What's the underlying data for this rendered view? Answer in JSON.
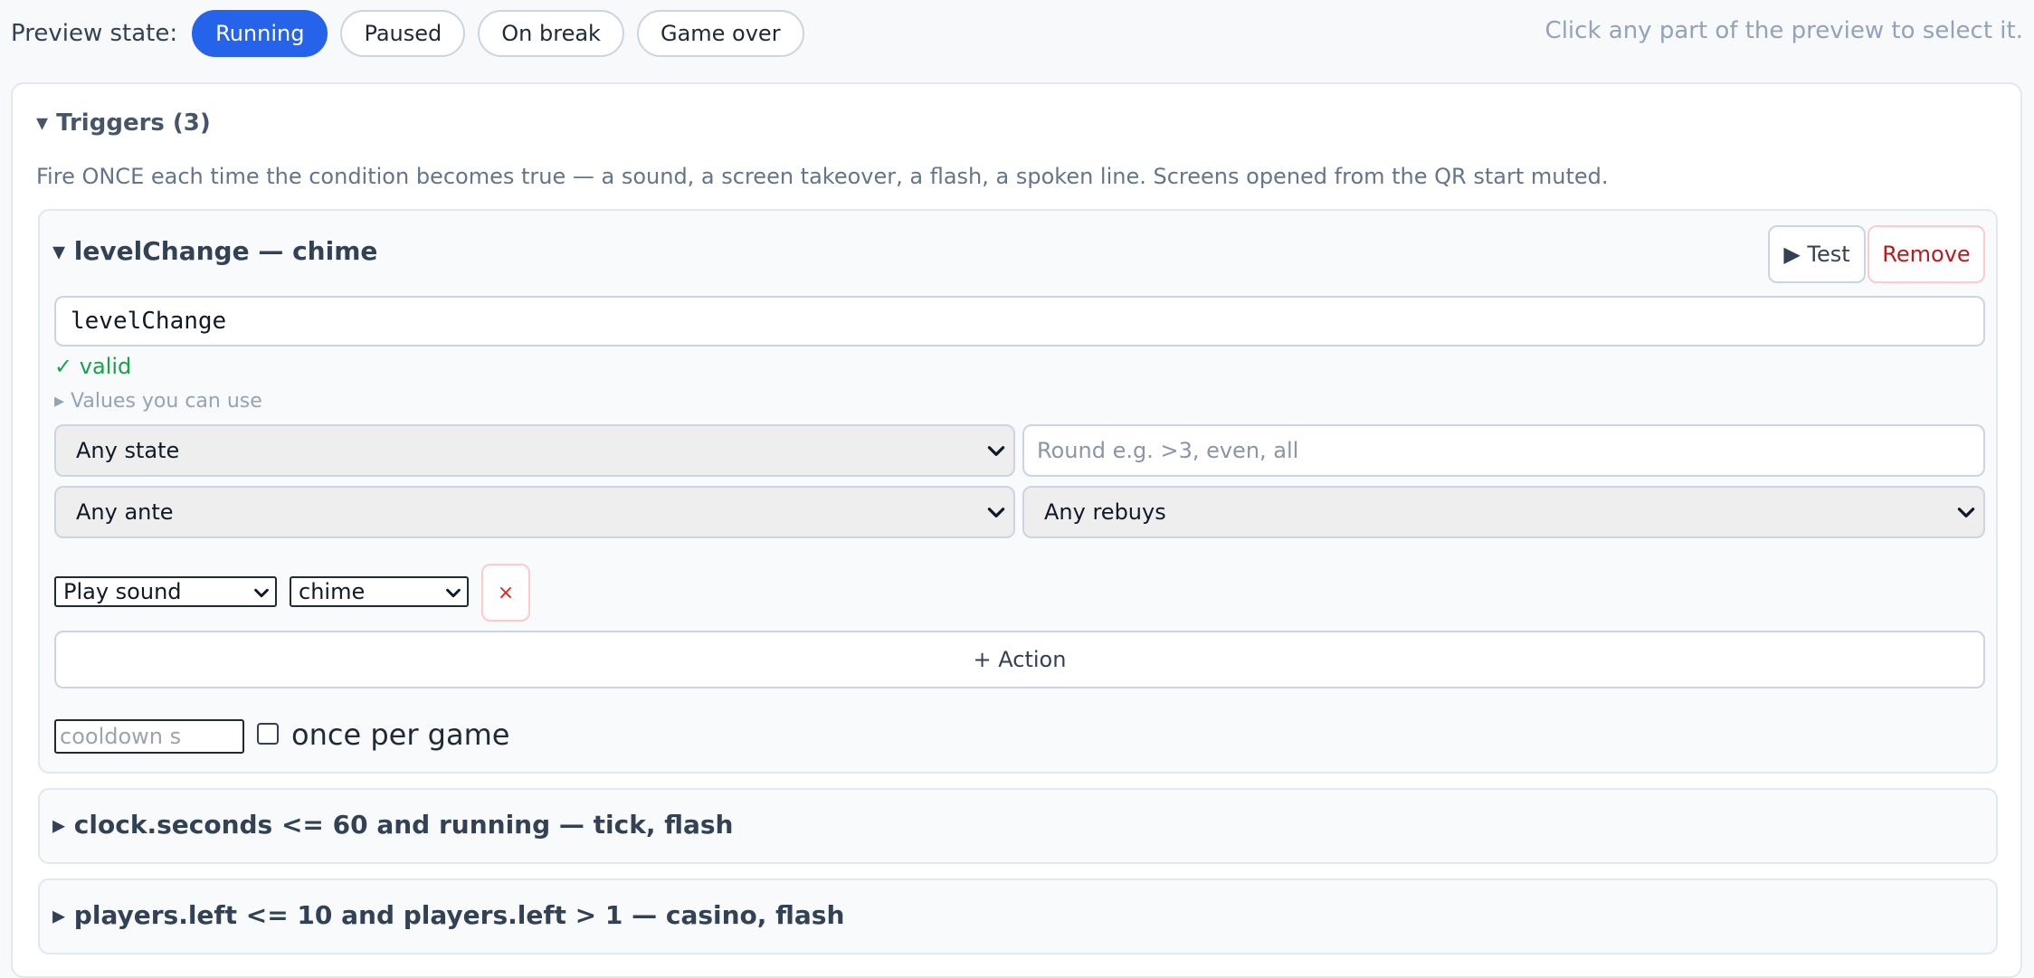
{
  "topbar": {
    "label": "Preview state:",
    "states": [
      "Running",
      "Paused",
      "On break",
      "Game over"
    ],
    "active_state": "Running",
    "hint": "Click any part of the preview to select it."
  },
  "triggers": {
    "title": "▾ Triggers (3)",
    "description": "Fire ONCE each time the condition becomes true — a sound, a screen takeover, a flash, a spoken line. Screens opened from the QR start muted.",
    "items": [
      {
        "title": "▾ levelChange — chime",
        "expanded": true,
        "test_label": "▶ Test",
        "remove_label": "Remove",
        "condition": "levelChange",
        "valid_text": "✓ valid",
        "values_link": "▸ Values you can use",
        "state_select": "Any state",
        "round_placeholder": "Round e.g. >3, even, all",
        "ante_select": "Any ante",
        "rebuys_select": "Any rebuys",
        "action_type": "Play sound",
        "action_sound": "chime",
        "remove_action_label": "×",
        "add_action_label": "+ Action",
        "cooldown_placeholder": "cooldown s",
        "once_per_game_label": "once per game",
        "once_per_game_checked": false
      },
      {
        "title": "▸ clock.seconds <= 60 and running — tick, flash",
        "expanded": false
      },
      {
        "title": "▸ players.left <= 10 and players.left > 1 — casino, flash",
        "expanded": false
      }
    ]
  },
  "colors": {
    "accent": "#2563eb",
    "valid": "#16a34a",
    "danger": "#b91c1c"
  }
}
